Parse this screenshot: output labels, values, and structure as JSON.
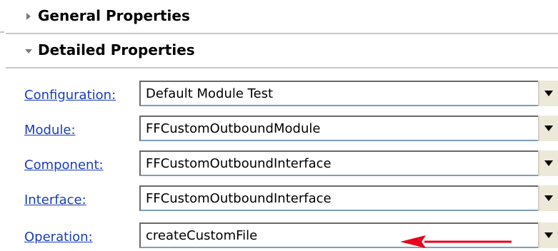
{
  "sections": {
    "general": {
      "title": "General Properties",
      "expanded": false
    },
    "detailed": {
      "title": "Detailed Properties",
      "expanded": true
    }
  },
  "fields": [
    {
      "label": "Configuration:",
      "value": "Default Module Test"
    },
    {
      "label": "Module:",
      "value": "FFCustomOutboundModule"
    },
    {
      "label": "Component:",
      "value": "FFCustomOutboundInterface"
    },
    {
      "label": "Interface:",
      "value": "FFCustomOutboundInterface"
    },
    {
      "label": "Operation:",
      "value": "createCustomFile"
    }
  ],
  "colors": {
    "link": "#1a3eb4",
    "annotation_arrow": "#e8001c",
    "divider": "#c8c8c8"
  },
  "icons": {
    "collapsed": "triangle-right-icon",
    "expanded": "triangle-down-icon",
    "dropdown": "dropdown-arrow-icon",
    "annotation": "red-arrow-icon"
  }
}
